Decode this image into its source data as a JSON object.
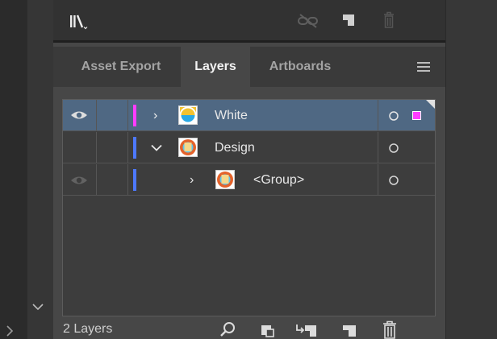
{
  "tabs": [
    {
      "label": "Asset Export"
    },
    {
      "label": "Layers"
    },
    {
      "label": "Artboards"
    }
  ],
  "layers": [
    {
      "name": "White",
      "expander": "›",
      "color": "#ff3cff"
    },
    {
      "name": "Design",
      "expander": "⌄",
      "color": "#4d79ff"
    },
    {
      "name": "<Group>",
      "expander": "›",
      "color": "#4d79ff"
    }
  ],
  "status": {
    "count": "2 Layers"
  },
  "colors": {
    "selection": "#4f6883",
    "panel": "#474747",
    "accent_magenta": "#ff3cff",
    "accent_blue": "#4d79ff"
  }
}
